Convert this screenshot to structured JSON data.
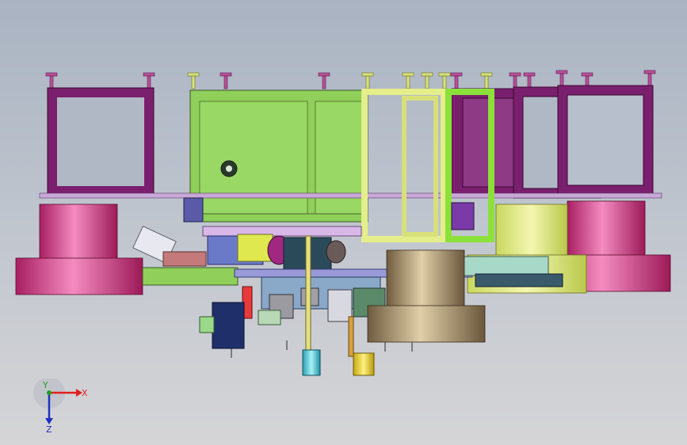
{
  "viewport": {
    "background_top": "#a9b3c2",
    "background_bottom": "#d5d5d7"
  },
  "colors": {
    "purple_frame": "#7a1f6e",
    "magenta_tank": "#d03a88",
    "green_housing": "#8fcf5a",
    "yellow_frame": "#e4ee8a",
    "lime_frame": "#8be03a",
    "bronze_motor": "#a08a66",
    "navy_part": "#1f2f6a",
    "cyan_part": "#49c8d8",
    "yellow_part": "#e8d22a"
  },
  "triad": {
    "x_label": "X",
    "y_label": "Y",
    "z_label": "Z",
    "x_color": "#e02020",
    "y_color": "#20a020",
    "z_color": "#2030c0"
  }
}
